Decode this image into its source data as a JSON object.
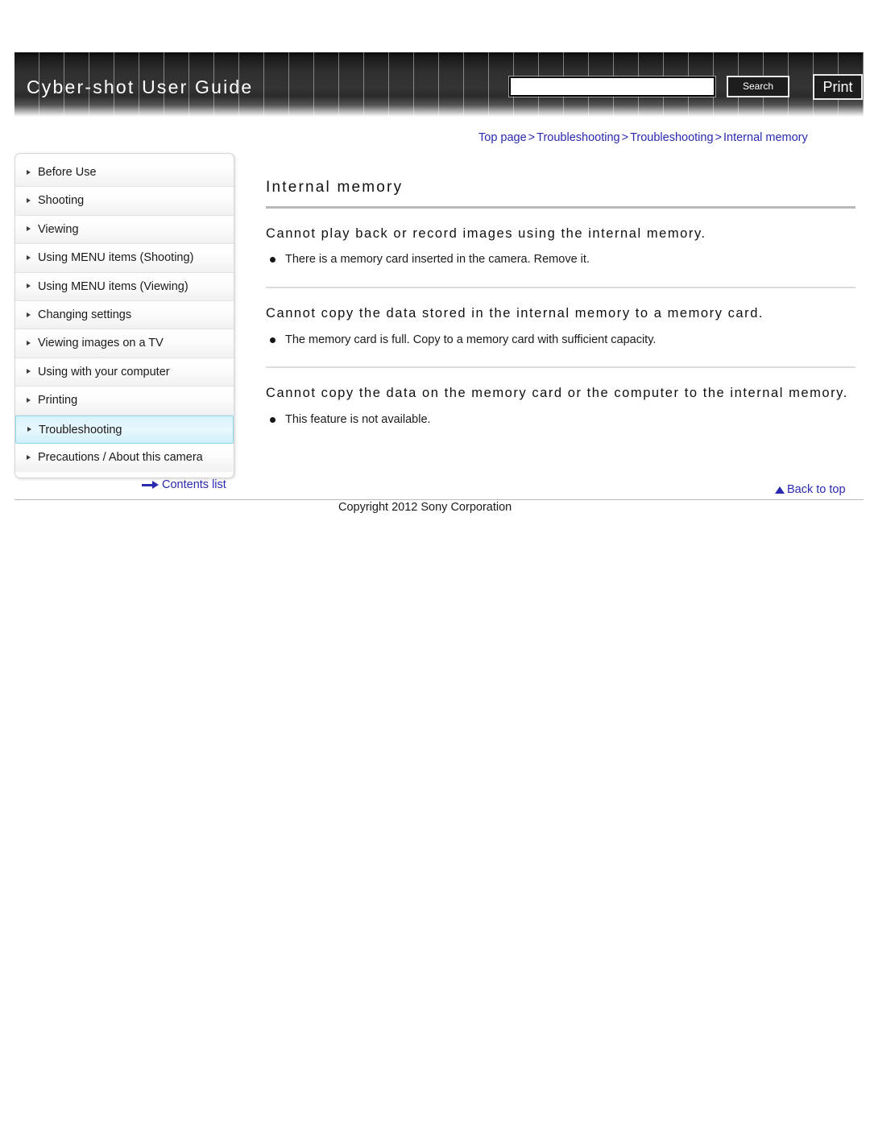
{
  "header": {
    "title": "Cyber-shot User Guide",
    "search_value": "",
    "search_placeholder": "",
    "search_button": "Search",
    "print_button": "Print"
  },
  "breadcrumb": {
    "items": [
      "Top page",
      "Troubleshooting",
      "Troubleshooting",
      "Internal memory"
    ],
    "separator": ">"
  },
  "sidebar": {
    "items": [
      {
        "label": "Before Use",
        "selected": false
      },
      {
        "label": "Shooting",
        "selected": false
      },
      {
        "label": "Viewing",
        "selected": false
      },
      {
        "label": "Using MENU items (Shooting)",
        "selected": false
      },
      {
        "label": "Using MENU items (Viewing)",
        "selected": false
      },
      {
        "label": "Changing settings",
        "selected": false
      },
      {
        "label": "Viewing images on a TV",
        "selected": false
      },
      {
        "label": "Using with your computer",
        "selected": false
      },
      {
        "label": "Printing",
        "selected": false
      },
      {
        "label": "Troubleshooting",
        "selected": true
      },
      {
        "label": "Precautions / About this camera",
        "selected": false
      }
    ],
    "contents_list_label": "Contents list"
  },
  "main": {
    "page_title": "Internal memory",
    "sections": [
      {
        "heading": "Cannot play back or record images using the internal memory.",
        "bullets": [
          "There is a memory card inserted in the camera. Remove it."
        ]
      },
      {
        "heading": "Cannot copy the data stored in the internal memory to a memory card.",
        "bullets": [
          "The memory card is full. Copy to a memory card with sufficient capacity."
        ]
      },
      {
        "heading": "Cannot copy the data on the memory card or the computer to the internal memory.",
        "bullets": [
          "This feature is not available."
        ]
      }
    ]
  },
  "footer": {
    "back_to_top_label": "Back to top",
    "copyright": "Copyright 2012 Sony Corporation"
  },
  "colors": {
    "link": "#2a2ab0",
    "selected_nav_bg": "#d8f3fb",
    "banner_dark": "#2f2f2f"
  }
}
